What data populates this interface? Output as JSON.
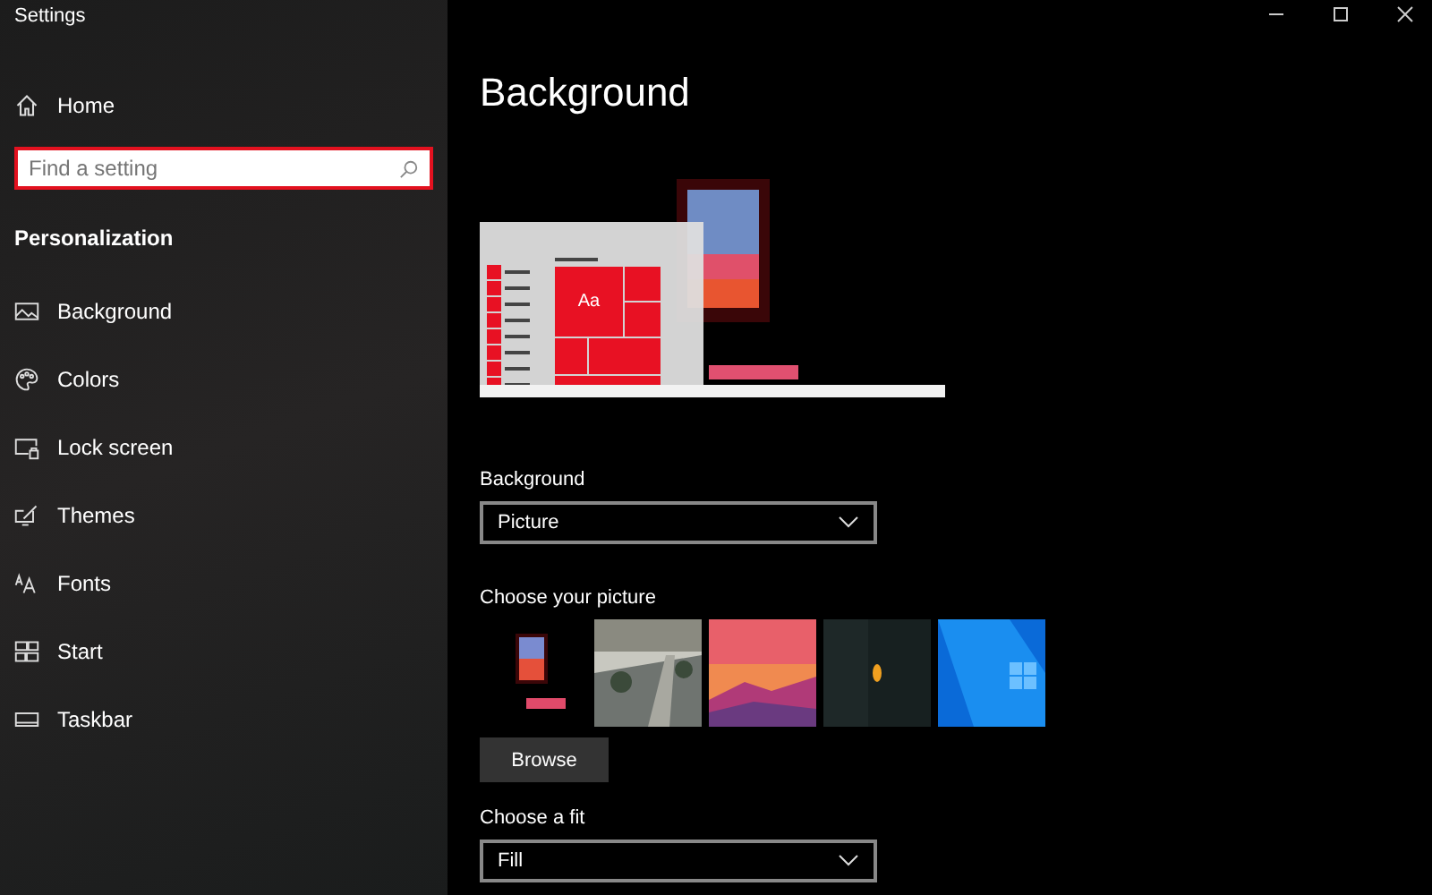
{
  "window": {
    "title": "Settings"
  },
  "sidebar": {
    "home": "Home",
    "search": {
      "placeholder": "Find a setting"
    },
    "section": "Personalization",
    "items": [
      {
        "label": "Background",
        "kind": "picture"
      },
      {
        "label": "Colors",
        "kind": "palette"
      },
      {
        "label": "Lock screen",
        "kind": "lock"
      },
      {
        "label": "Themes",
        "kind": "themes"
      },
      {
        "label": "Fonts",
        "kind": "fonts"
      },
      {
        "label": "Start",
        "kind": "start"
      },
      {
        "label": "Taskbar",
        "kind": "taskbar"
      }
    ]
  },
  "page": {
    "title": "Background",
    "preview": {
      "sample_text": "Aa"
    },
    "background": {
      "label": "Background",
      "value": "Picture"
    },
    "choose_picture": {
      "label": "Choose your picture",
      "pictures": [
        {
          "kind": "window"
        },
        {
          "kind": "road"
        },
        {
          "kind": "sunset"
        },
        {
          "kind": "dark"
        },
        {
          "kind": "windows"
        }
      ]
    },
    "browse": "Browse",
    "fit": {
      "label": "Choose a fit",
      "value": "Fill"
    }
  }
}
